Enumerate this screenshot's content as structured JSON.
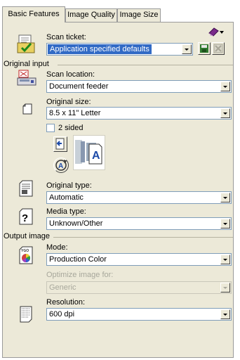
{
  "tabs": [
    {
      "label": "Basic Features",
      "active": true
    },
    {
      "label": "Image Quality",
      "active": false
    },
    {
      "label": "Image Size",
      "active": false
    }
  ],
  "scan_ticket": {
    "label": "Scan ticket:",
    "value": "Application specified defaults"
  },
  "original_input": {
    "heading": "Original input",
    "scan_location": {
      "label": "Scan location:",
      "value": "Document feeder"
    },
    "original_size": {
      "label": "Original size:",
      "value": "8.5 x 11\" Letter"
    },
    "two_sided": {
      "label": "2 sided",
      "checked": false
    },
    "original_type": {
      "label": "Original type:",
      "value": "Automatic"
    },
    "media_type": {
      "label": "Media type:",
      "value": "Unknown/Other"
    }
  },
  "output_image": {
    "heading": "Output image",
    "mode": {
      "label": "Mode:",
      "value": "Production Color"
    },
    "optimize": {
      "label": "Optimize image for:",
      "value": "Generic",
      "enabled": false
    },
    "resolution": {
      "label": "Resolution:",
      "value": "600 dpi"
    }
  },
  "colors": {
    "panel_bg": "#ece9d8",
    "selection": "#316ac5",
    "input_border": "#7f9db9"
  },
  "icons": [
    "scan-ticket-icon",
    "eraser-menu-icon",
    "save-icon",
    "delete-icon",
    "scanner-icon",
    "page-icon",
    "feed-direction-icon",
    "rotate-icon",
    "document-preview-icon",
    "original-type-icon",
    "media-type-icon",
    "color-mode-icon",
    "resolution-icon"
  ]
}
